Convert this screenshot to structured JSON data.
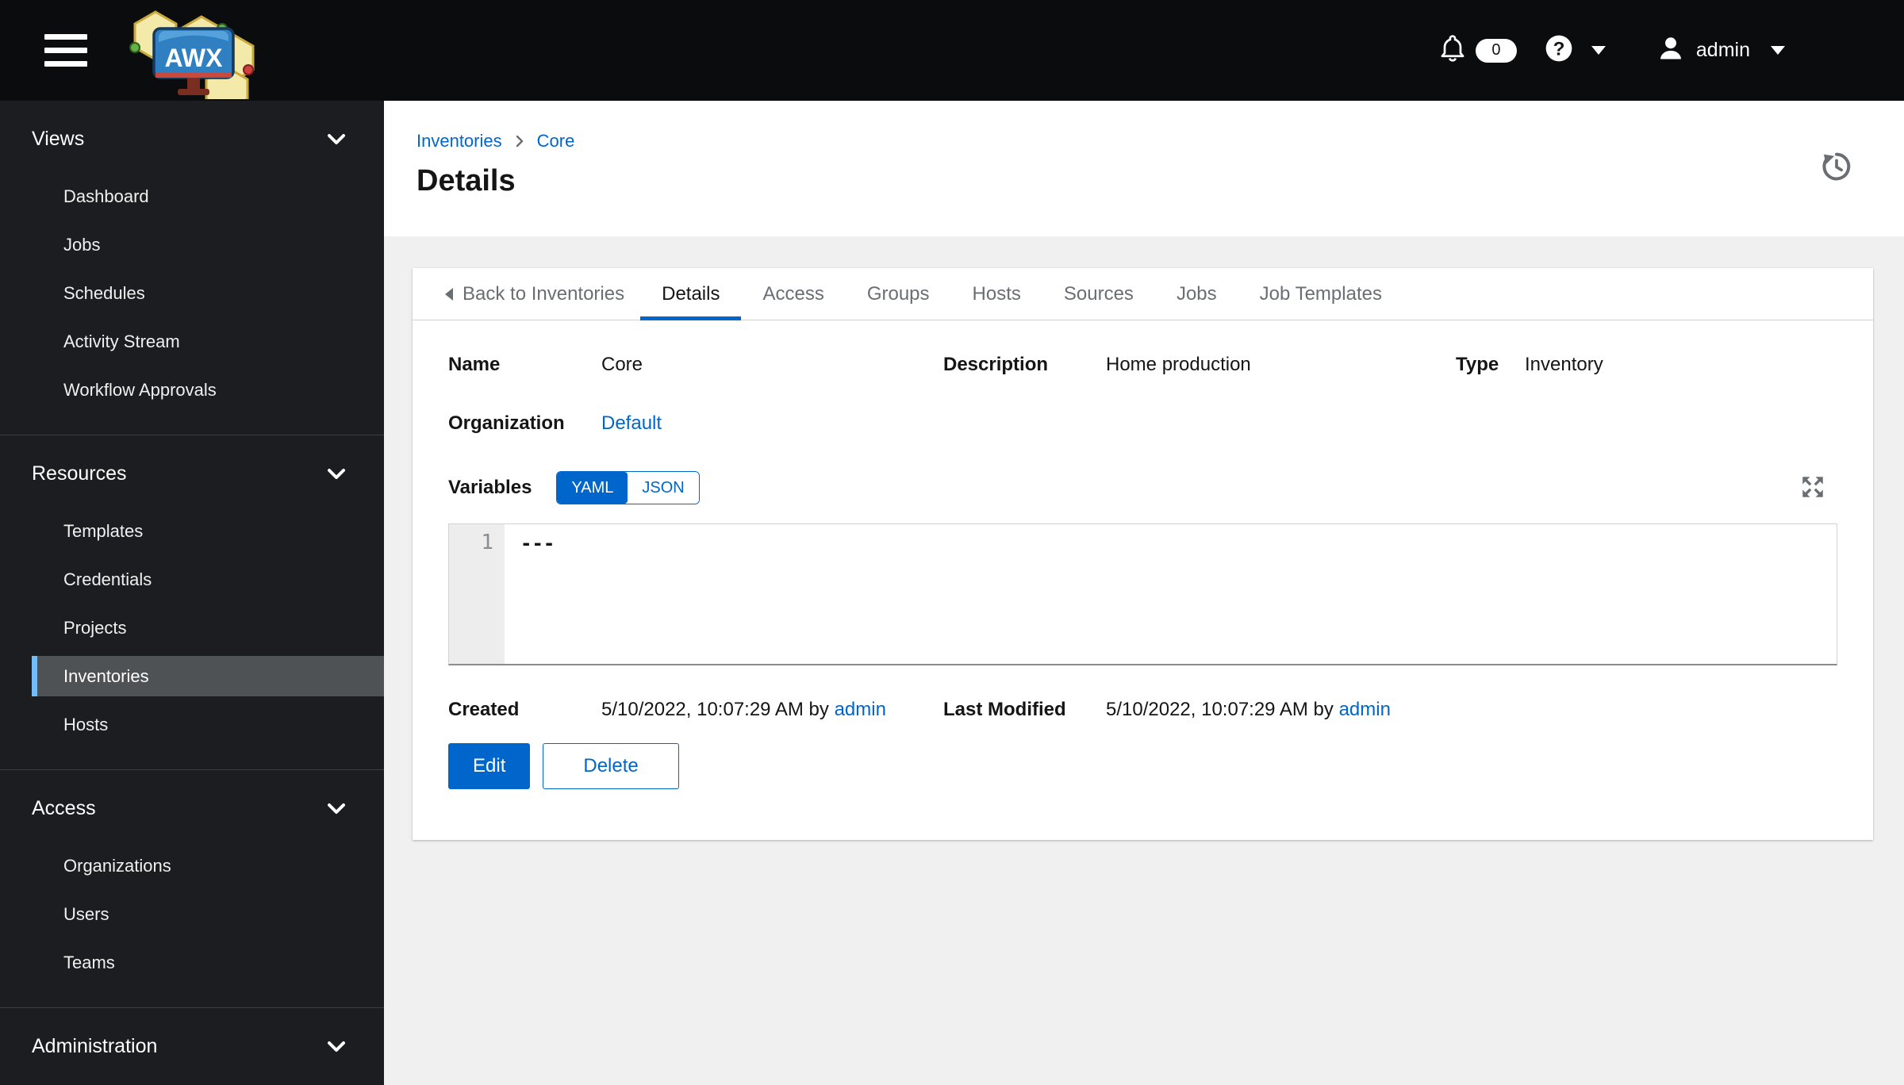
{
  "topbar": {
    "brand": "AWX",
    "notifications_count": "0",
    "username": "admin"
  },
  "sidebar": {
    "sections": [
      {
        "label": "Views",
        "items": [
          "Dashboard",
          "Jobs",
          "Schedules",
          "Activity Stream",
          "Workflow Approvals"
        ]
      },
      {
        "label": "Resources",
        "items": [
          "Templates",
          "Credentials",
          "Projects",
          "Inventories",
          "Hosts"
        ],
        "selected_item": "Inventories"
      },
      {
        "label": "Access",
        "items": [
          "Organizations",
          "Users",
          "Teams"
        ]
      },
      {
        "label": "Administration",
        "items": []
      }
    ]
  },
  "header": {
    "breadcrumb": {
      "inventories": "Inventories",
      "current": "Core"
    },
    "title": "Details"
  },
  "tabs": {
    "back_label": "Back to Inventories",
    "items": [
      "Details",
      "Access",
      "Groups",
      "Hosts",
      "Sources",
      "Jobs",
      "Job Templates"
    ],
    "active": "Details"
  },
  "details": {
    "name_label": "Name",
    "name_value": "Core",
    "description_label": "Description",
    "description_value": "Home production",
    "type_label": "Type",
    "type_value": "Inventory",
    "organization_label": "Organization",
    "organization_value": "Default",
    "variables_label": "Variables",
    "yaml_label": "YAML",
    "json_label": "JSON",
    "variables_format": "YAML",
    "editor": {
      "line_number": "1",
      "content": "---"
    },
    "created_label": "Created",
    "created_value": "5/10/2022, 10:07:29 AM by",
    "created_by": "admin",
    "modified_label": "Last Modified",
    "modified_value": "5/10/2022, 10:07:29 AM by",
    "modified_by": "admin",
    "edit_label": "Edit",
    "delete_label": "Delete"
  },
  "colors": {
    "primary": "#0066cc",
    "link": "#0066cc",
    "nav_selected_accent": "#73bcf7",
    "nav_selected_bg": "#4f5255",
    "sidebar_bg": "#1b1d21",
    "topbar_bg": "#0b0c0e",
    "content_bg": "#f0f0f0",
    "tab_inactive_text": "#6a6e73",
    "active_tab_underline": "#0066cc"
  }
}
